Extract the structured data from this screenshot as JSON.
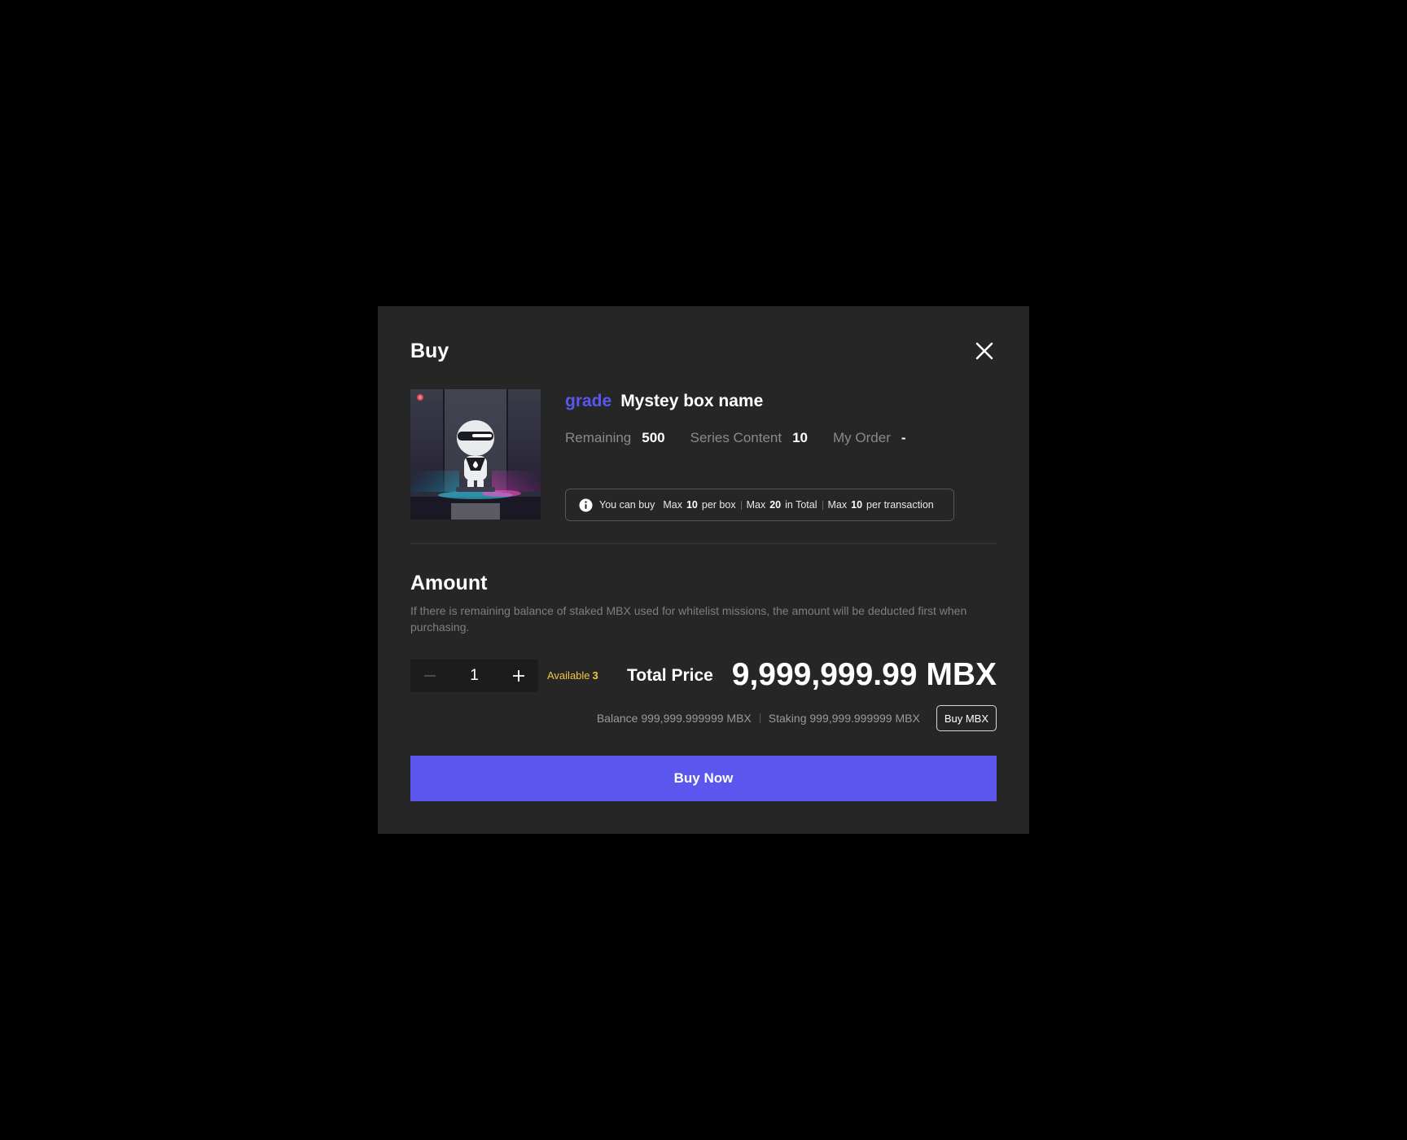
{
  "modal": {
    "title": "Buy",
    "close_icon": "close-icon"
  },
  "product": {
    "image_icon": "robot-mystery-box-image",
    "grade": "grade",
    "name": "Mystey box name",
    "stats": [
      {
        "label": "Remaining",
        "value": "500"
      },
      {
        "label": "Series Content",
        "value": "10"
      },
      {
        "label": "My Order",
        "value": "-"
      }
    ],
    "limits": {
      "icon": "info-icon",
      "intro": "You can buy",
      "max_label": "Max",
      "per_box_value": "10",
      "per_box_label": "per box",
      "total_value": "20",
      "total_label": "in Total",
      "per_tx_value": "10",
      "per_tx_label": "per transaction"
    }
  },
  "amount": {
    "heading": "Amount",
    "description": "If there is remaining balance of staked MBX used for whitelist missions, the amount will be deducted first when purchasing.",
    "quantity": "1",
    "available_label": "Available",
    "available_value": "3",
    "total_price_label": "Total Price",
    "total_price_value": "9,999,999.99 MBX",
    "balance": "Balance 999,999.999999 MBX",
    "staking": "Staking 999,999.999999 MBX",
    "buy_mbx_label": "Buy MBX"
  },
  "cta": {
    "buy_now_label": "Buy Now"
  },
  "colors": {
    "accent": "#5b57ee",
    "available": "#f3c63f",
    "panel": "#262626",
    "backdrop": "#000000"
  }
}
